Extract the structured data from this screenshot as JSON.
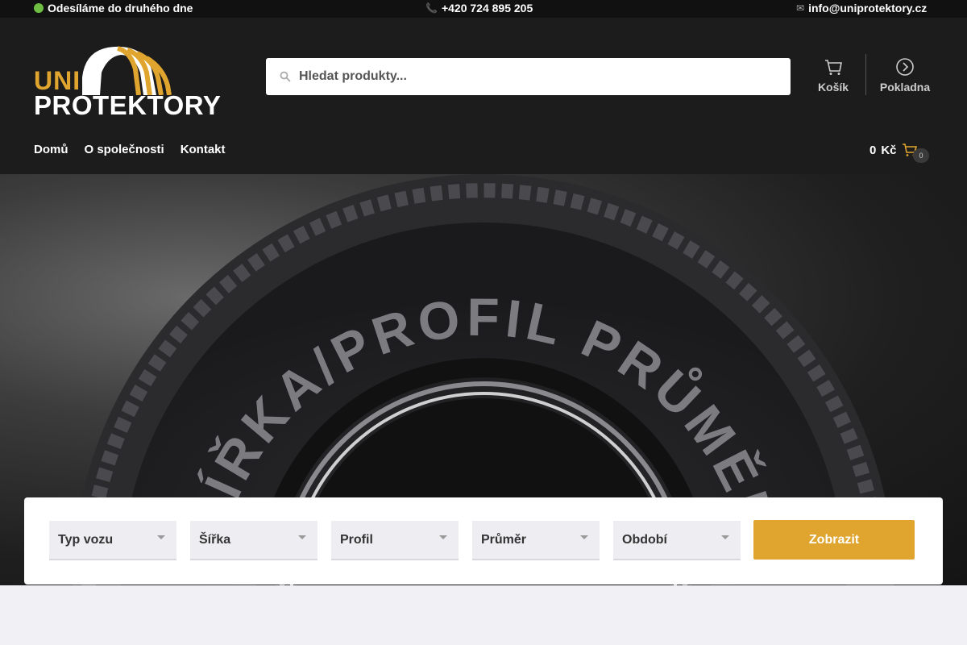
{
  "topbar": {
    "shipping": "Odesíláme do druhého dne",
    "phone": "+420 724 895 205",
    "email": "info@uniprotektory.cz"
  },
  "logo": {
    "line1": "UNI",
    "line2": "PROTEKTORY"
  },
  "search": {
    "placeholder": "Hledat produkty..."
  },
  "header_buttons": {
    "cart": "Košík",
    "checkout": "Pokladna"
  },
  "nav": {
    "home": "Domů",
    "about": "O společnosti",
    "contact": "Kontakt"
  },
  "cart": {
    "total": "0",
    "currency": "Kč",
    "count": "0"
  },
  "hero": {
    "tire_text": "ŠÍŘKA/PROFIL PRŮMĚR"
  },
  "filter": {
    "type": "Typ vozu",
    "width": "Šířka",
    "profile": "Profil",
    "diameter": "Průměr",
    "season": "Období",
    "submit": "Zobrazit"
  },
  "colors": {
    "accent": "#e0a52f",
    "header_bg": "#1c1c1c",
    "topbar_bg": "#111111"
  }
}
